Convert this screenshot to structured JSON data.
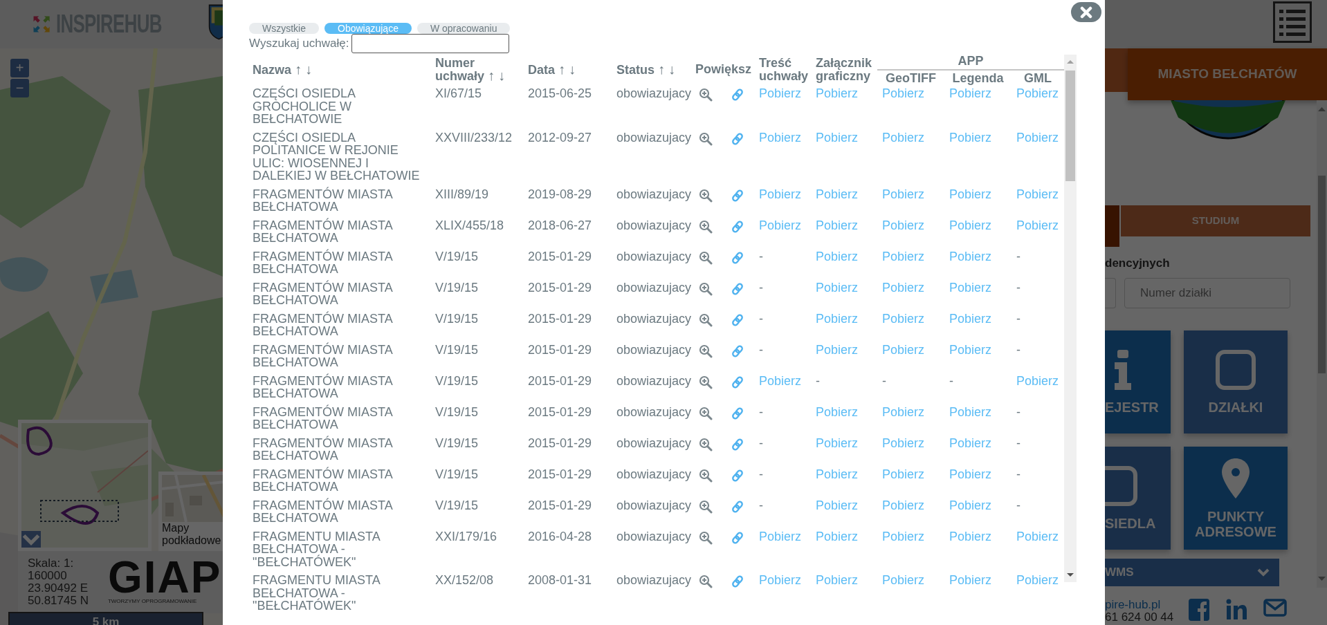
{
  "header": {
    "logo": "INSPIRE**HUB**"
  },
  "map": {
    "zoom_in": "+",
    "zoom_out": "−",
    "basemap_label": "Mapy podkładowe",
    "scale_label": "Skala: 1:",
    "scale_value": "160000",
    "longitude": "23.90492 E",
    "latitude": "50.81745 N",
    "brand": "GIAP",
    "brand_tagline": "TWORZYMY OPROGRAMOWANIE",
    "scalebar": "5 km"
  },
  "sidebar": {
    "title": "MIASTO BEŁCHATÓW",
    "tabs": [
      {
        "label": "STUDIUM",
        "selected": false
      }
    ],
    "section_heading": "dencyjnych",
    "parcel_field": {
      "placeholder": "Numer działki"
    },
    "tiles": [
      {
        "label": "EJESTR",
        "kind": "info",
        "active": true
      },
      {
        "label": "DZIAŁKI",
        "kind": "square",
        "active": false
      },
      {
        "label": "SIEDLA",
        "kind": "square",
        "active": false
      },
      {
        "label": "PUNKTY ADRESOWE",
        "kind": "pin",
        "active": true
      }
    ],
    "layers_bar": "WMS",
    "website": "pire-hub.pl",
    "phone": "61 624 00 44"
  },
  "modal": {
    "filter_tabs": [
      {
        "label": "Wszystkie",
        "selected": false
      },
      {
        "label": "Obowiązujące",
        "selected": true
      },
      {
        "label": "W opracowaniu",
        "selected": false
      }
    ],
    "search": {
      "label": "Wyszukaj uchwałę:"
    },
    "table": {
      "columns": [
        {
          "label": "Nazwa",
          "kind": "sortable",
          "sort_arrows": [
            "↑",
            "↓"
          ]
        },
        {
          "label": "Numer uchwały",
          "kind": "sortable",
          "sort_arrows": [
            "↑",
            "↓"
          ]
        },
        {
          "label": "Data",
          "kind": "sortable",
          "sort_arrows": [
            "↑",
            "↓"
          ]
        },
        {
          "label": "Status",
          "kind": "sortable",
          "sort_arrows": [
            "↑",
            "↓"
          ]
        },
        {
          "label": "Powiększ",
          "kind": "actions"
        },
        {
          "label": "Treść uchwały",
          "kind": "plain"
        },
        {
          "label": "Załącznik graficzny",
          "kind": "plain"
        },
        {
          "label": "APP",
          "kind": "group",
          "children": [
            {
              "label": "GeoTIFF"
            },
            {
              "label": "Legenda"
            },
            {
              "label": "GML"
            }
          ]
        }
      ],
      "rows": [
        {
          "name": "CZĘŚCI OSIEDLA GROCHOLICE W BEŁCHATOWIE",
          "number": "XI/67/15",
          "date": "2015-06-25",
          "status": "obowiazujacy",
          "downloads": [
            {
              "kind": "link",
              "text": "Pobierz"
            },
            {
              "kind": "link",
              "text": "Pobierz"
            },
            {
              "kind": "link",
              "text": "Pobierz"
            },
            {
              "kind": "link",
              "text": "Pobierz"
            },
            {
              "kind": "link",
              "text": "Pobierz"
            }
          ]
        },
        {
          "name": "CZĘŚCI OSIEDLA POLITANICE W REJONIE ULIC: WIOSENNEJ I DALEKIEJ W BEŁCHATOWIE",
          "number": "XXVIII/233/12",
          "date": "2012-09-27",
          "status": "obowiazujacy",
          "downloads": [
            {
              "kind": "link",
              "text": "Pobierz"
            },
            {
              "kind": "link",
              "text": "Pobierz"
            },
            {
              "kind": "link",
              "text": "Pobierz"
            },
            {
              "kind": "link",
              "text": "Pobierz"
            },
            {
              "kind": "link",
              "text": "Pobierz"
            }
          ]
        },
        {
          "name": "FRAGMENTÓW MIASTA BEŁCHATOWA",
          "number": "XIII/89/19",
          "date": "2019-08-29",
          "status": "obowiazujacy",
          "downloads": [
            {
              "kind": "link",
              "text": "Pobierz"
            },
            {
              "kind": "link",
              "text": "Pobierz"
            },
            {
              "kind": "link",
              "text": "Pobierz"
            },
            {
              "kind": "link",
              "text": "Pobierz"
            },
            {
              "kind": "link",
              "text": "Pobierz"
            }
          ]
        },
        {
          "name": "FRAGMENTÓW MIASTA BEŁCHATOWA",
          "number": "XLIX/455/18",
          "date": "2018-06-27",
          "status": "obowiazujacy",
          "downloads": [
            {
              "kind": "link",
              "text": "Pobierz"
            },
            {
              "kind": "link",
              "text": "Pobierz"
            },
            {
              "kind": "link",
              "text": "Pobierz"
            },
            {
              "kind": "link",
              "text": "Pobierz"
            },
            {
              "kind": "link",
              "text": "Pobierz"
            }
          ]
        },
        {
          "name": "FRAGMENTÓW MIASTA BEŁCHATOWA",
          "number": "V/19/15",
          "date": "2015-01-29",
          "status": "obowiazujacy",
          "downloads": [
            {
              "kind": "none",
              "text": "-"
            },
            {
              "kind": "link",
              "text": "Pobierz"
            },
            {
              "kind": "link",
              "text": "Pobierz"
            },
            {
              "kind": "link",
              "text": "Pobierz"
            },
            {
              "kind": "none",
              "text": "-"
            }
          ]
        },
        {
          "name": "FRAGMENTÓW MIASTA BEŁCHATOWA",
          "number": "V/19/15",
          "date": "2015-01-29",
          "status": "obowiazujacy",
          "downloads": [
            {
              "kind": "none",
              "text": "-"
            },
            {
              "kind": "link",
              "text": "Pobierz"
            },
            {
              "kind": "link",
              "text": "Pobierz"
            },
            {
              "kind": "link",
              "text": "Pobierz"
            },
            {
              "kind": "none",
              "text": "-"
            }
          ]
        },
        {
          "name": "FRAGMENTÓW MIASTA BEŁCHATOWA",
          "number": "V/19/15",
          "date": "2015-01-29",
          "status": "obowiazujacy",
          "downloads": [
            {
              "kind": "none",
              "text": "-"
            },
            {
              "kind": "link",
              "text": "Pobierz"
            },
            {
              "kind": "link",
              "text": "Pobierz"
            },
            {
              "kind": "link",
              "text": "Pobierz"
            },
            {
              "kind": "none",
              "text": "-"
            }
          ]
        },
        {
          "name": "FRAGMENTÓW MIASTA BEŁCHATOWA",
          "number": "V/19/15",
          "date": "2015-01-29",
          "status": "obowiazujacy",
          "downloads": [
            {
              "kind": "none",
              "text": "-"
            },
            {
              "kind": "link",
              "text": "Pobierz"
            },
            {
              "kind": "link",
              "text": "Pobierz"
            },
            {
              "kind": "link",
              "text": "Pobierz"
            },
            {
              "kind": "none",
              "text": "-"
            }
          ]
        },
        {
          "name": "FRAGMENTÓW MIASTA BEŁCHATOWA",
          "number": "V/19/15",
          "date": "2015-01-29",
          "status": "obowiazujacy",
          "downloads": [
            {
              "kind": "link",
              "text": "Pobierz"
            },
            {
              "kind": "none",
              "text": "-"
            },
            {
              "kind": "none",
              "text": "-"
            },
            {
              "kind": "none",
              "text": "-"
            },
            {
              "kind": "link",
              "text": "Pobierz"
            }
          ]
        },
        {
          "name": "FRAGMENTÓW MIASTA BEŁCHATOWA",
          "number": "V/19/15",
          "date": "2015-01-29",
          "status": "obowiazujacy",
          "downloads": [
            {
              "kind": "none",
              "text": "-"
            },
            {
              "kind": "link",
              "text": "Pobierz"
            },
            {
              "kind": "link",
              "text": "Pobierz"
            },
            {
              "kind": "link",
              "text": "Pobierz"
            },
            {
              "kind": "none",
              "text": "-"
            }
          ]
        },
        {
          "name": "FRAGMENTÓW MIASTA BEŁCHATOWA",
          "number": "V/19/15",
          "date": "2015-01-29",
          "status": "obowiazujacy",
          "downloads": [
            {
              "kind": "none",
              "text": "-"
            },
            {
              "kind": "link",
              "text": "Pobierz"
            },
            {
              "kind": "link",
              "text": "Pobierz"
            },
            {
              "kind": "link",
              "text": "Pobierz"
            },
            {
              "kind": "none",
              "text": "-"
            }
          ]
        },
        {
          "name": "FRAGMENTÓW MIASTA BEŁCHATOWA",
          "number": "V/19/15",
          "date": "2015-01-29",
          "status": "obowiazujacy",
          "downloads": [
            {
              "kind": "none",
              "text": "-"
            },
            {
              "kind": "link",
              "text": "Pobierz"
            },
            {
              "kind": "link",
              "text": "Pobierz"
            },
            {
              "kind": "link",
              "text": "Pobierz"
            },
            {
              "kind": "none",
              "text": "-"
            }
          ]
        },
        {
          "name": "FRAGMENTÓW MIASTA BEŁCHATOWA",
          "number": "V/19/15",
          "date": "2015-01-29",
          "status": "obowiazujacy",
          "downloads": [
            {
              "kind": "none",
              "text": "-"
            },
            {
              "kind": "link",
              "text": "Pobierz"
            },
            {
              "kind": "link",
              "text": "Pobierz"
            },
            {
              "kind": "link",
              "text": "Pobierz"
            },
            {
              "kind": "none",
              "text": "-"
            }
          ]
        },
        {
          "name": "FRAGMENTU MIASTA BEŁCHATOWA - \"BEŁCHATÓWEK\"",
          "number": "XXI/179/16",
          "date": "2016-04-28",
          "status": "obowiazujacy",
          "downloads": [
            {
              "kind": "link",
              "text": "Pobierz"
            },
            {
              "kind": "link",
              "text": "Pobierz"
            },
            {
              "kind": "link",
              "text": "Pobierz"
            },
            {
              "kind": "link",
              "text": "Pobierz"
            },
            {
              "kind": "link",
              "text": "Pobierz"
            }
          ]
        },
        {
          "name": "FRAGMENTU MIASTA BEŁCHATOWA - \"BEŁCHATÓWEK\"",
          "number": "XX/152/08",
          "date": "2008-01-31",
          "status": "obowiazujacy",
          "downloads": [
            {
              "kind": "link",
              "text": "Pobierz"
            },
            {
              "kind": "link",
              "text": "Pobierz"
            },
            {
              "kind": "link",
              "text": "Pobierz"
            },
            {
              "kind": "link",
              "text": "Pobierz"
            },
            {
              "kind": "link",
              "text": "Pobierz"
            }
          ]
        }
      ]
    }
  }
}
